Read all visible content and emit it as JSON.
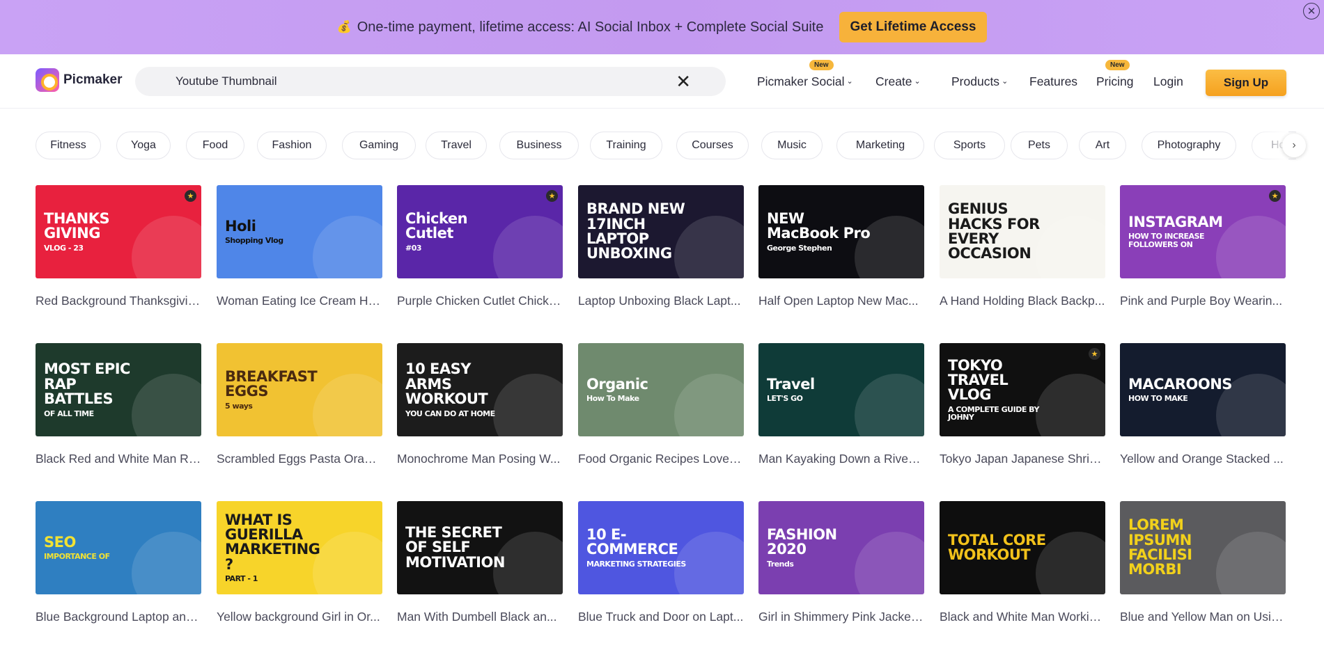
{
  "promo": {
    "emoji": "💰",
    "text": "One-time payment, lifetime access: AI Social Inbox + Complete Social Suite",
    "button": "Get Lifetime Access",
    "close": "✕"
  },
  "header": {
    "logo": "Picmaker",
    "search_value": "Youtube Thumbnail",
    "search_clear": "✕",
    "nav": {
      "social": "Picmaker Social",
      "create": "Create",
      "products": "Products",
      "features": "Features",
      "pricing": "Pricing",
      "login": "Login",
      "signup": "Sign Up",
      "new_badge": "New",
      "chevron": "⌄"
    }
  },
  "categories": [
    "Fitness",
    "Yoga",
    "Food",
    "Fashion",
    "Gaming",
    "Travel",
    "Business",
    "Training",
    "Courses",
    "Music",
    "Marketing",
    "Sports",
    "Pets",
    "Art",
    "Photography",
    "Hol"
  ],
  "categories_next": "›",
  "star": "★",
  "templates": [
    {
      "label": "Red Background Thanksgivin...",
      "title": "THANKS GIVING",
      "sub": "VLOG - 23",
      "bg": "#e8213e",
      "fg": "#ffffff",
      "starred": true
    },
    {
      "label": "Woman Eating Ice Cream Ho...",
      "title": "Holi",
      "sub": "Shopping Vlog",
      "bg": "#4f86e8",
      "fg": "#111111",
      "starred": false
    },
    {
      "label": "Purple Chicken Cutlet Chicke...",
      "title": "Chicken Cutlet",
      "sub": "#03",
      "bg": "#5a26a8",
      "fg": "#ffffff",
      "starred": true
    },
    {
      "label": "Laptop Unboxing Black Lapt...",
      "title": "BRAND NEW 17INCH LAPTOP UNBOXING",
      "sub": "",
      "bg": "#1c1830",
      "fg": "#ffffff",
      "starred": false
    },
    {
      "label": "Half Open Laptop New Mac...",
      "title": "NEW MacBook Pro",
      "sub": "George Stephen",
      "bg": "#0d0d12",
      "fg": "#ffffff",
      "starred": false
    },
    {
      "label": "A Hand Holding Black Backp...",
      "title": "GENIUS HACKS FOR EVERY OCCASION",
      "sub": "",
      "bg": "#f6f5f0",
      "fg": "#1a1a1a",
      "starred": false
    },
    {
      "label": "Pink and Purple Boy Wearin...",
      "title": "INSTAGRAM",
      "sub": "HOW TO INCREASE FOLLOWERS ON",
      "bg": "#8a3fb8",
      "fg": "#ffffff",
      "starred": true
    },
    {
      "label": "Black Red and White Man Ra...",
      "title": "MOST EPIC RAP BATTLES",
      "sub": "OF ALL TIME",
      "bg": "#1e3a2c",
      "fg": "#ffffff",
      "starred": false
    },
    {
      "label": "Scrambled Eggs Pasta Orang...",
      "title": "BREAKFAST EGGS",
      "sub": "5 ways",
      "bg": "#f1c232",
      "fg": "#4a2a10",
      "starred": false
    },
    {
      "label": "Monochrome Man Posing W...",
      "title": "10 EASY ARMS WORKOUT",
      "sub": "YOU CAN DO AT HOME",
      "bg": "#1c1c1c",
      "fg": "#ffffff",
      "starred": false
    },
    {
      "label": "Food Organic Recipes Love i...",
      "title": "Organic",
      "sub": "How To Make",
      "bg": "#6f8a6e",
      "fg": "#ffffff",
      "starred": false
    },
    {
      "label": "Man Kayaking Down a River ...",
      "title": "Travel",
      "sub": "LET'S GO",
      "bg": "#0f3b38",
      "fg": "#ffffff",
      "starred": false
    },
    {
      "label": "Tokyo Japan Japanese Shrine...",
      "title": "TOKYO TRAVEL VLOG",
      "sub": "A COMPLETE GUIDE BY JOHNY",
      "bg": "#101010",
      "fg": "#ffffff",
      "starred": true
    },
    {
      "label": "Yellow and Orange Stacked ...",
      "title": "MACAROONS",
      "sub": "HOW TO MAKE",
      "bg": "#141c2e",
      "fg": "#ffffff",
      "starred": false
    },
    {
      "label": "Blue Background Laptop and...",
      "title": "SEO",
      "sub": "IMPORTANCE OF",
      "bg": "#2f7fc1",
      "fg": "#f2e233",
      "starred": false
    },
    {
      "label": "Yellow background Girl in Or...",
      "title": "WHAT IS GUERILLA MARKETING ?",
      "sub": "PART - 1",
      "bg": "#f7d42a",
      "fg": "#1a1a1a",
      "starred": false
    },
    {
      "label": "Man With Dumbell Black an...",
      "title": "THE SECRET OF SELF MOTIVATION",
      "sub": "",
      "bg": "#121212",
      "fg": "#ffffff",
      "starred": false
    },
    {
      "label": "Blue Truck and Door on Lapt...",
      "title": "10 E-COMMERCE",
      "sub": "MARKETING STRATEGIES",
      "bg": "#4f56e0",
      "fg": "#ffffff",
      "starred": false
    },
    {
      "label": "Girl in Shimmery Pink Jacket ...",
      "title": "FASHION 2020",
      "sub": "Trends",
      "bg": "#7b3fb0",
      "fg": "#ffffff",
      "starred": false
    },
    {
      "label": "Black and White Man Workin...",
      "title": "TOTAL CORE WORKOUT",
      "sub": "",
      "bg": "#0e0e0e",
      "fg": "#f2c21b",
      "starred": false
    },
    {
      "label": "Blue and Yellow Man on Usin...",
      "title": "LOREM IPSUMN FACILISI MORBI",
      "sub": "",
      "bg": "#5b5b5e",
      "fg": "#f2d11b",
      "starred": false
    }
  ]
}
